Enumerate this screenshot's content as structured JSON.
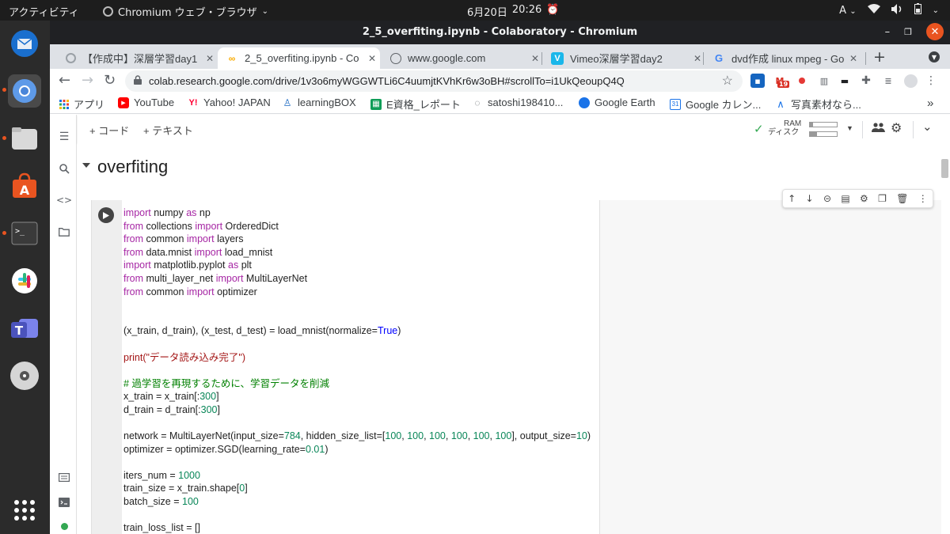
{
  "system": {
    "activities": "アクティビティ",
    "app_menu": "Chromium ウェブ・ブラウザ",
    "date": "6月20日",
    "time": "20:26",
    "input_method": "A"
  },
  "window": {
    "title": "2_5_overfiting.ipynb - Colaboratory - Chromium"
  },
  "tabs": [
    {
      "label": "【作成中】深層学習day1",
      "active": false
    },
    {
      "label": "2_5_overfiting.ipynb - Co",
      "active": true
    },
    {
      "label": "www.google.com",
      "active": false
    },
    {
      "label": "Vimeo深層学習day2",
      "active": false
    },
    {
      "label": "dvd作成 linux mpeg - Goo",
      "active": false
    }
  ],
  "toolbar": {
    "url": "colab.research.google.com/drive/1v3o6myWGGWTLi6C4uumjtKVhKr6w3oBH#scrollTo=i1UkQeoupQ4Q",
    "gmail_badge": "19"
  },
  "bookmarks": [
    {
      "label": "アプリ"
    },
    {
      "label": "YouTube"
    },
    {
      "label": "Yahoo! JAPAN"
    },
    {
      "label": "learningBOX"
    },
    {
      "label": "E資格_レポート"
    },
    {
      "label": "satoshi198410..."
    },
    {
      "label": "Google Earth"
    },
    {
      "label": "Google カレン..."
    },
    {
      "label": "写真素材なら..."
    }
  ],
  "colab": {
    "add_code": "+ コード",
    "add_text": "+ テキスト",
    "ram_label": "RAM",
    "disk_label": "ディスク",
    "ram_usage": 0.12,
    "disk_usage": 0.25,
    "section_title": "overfiting"
  },
  "code_lines": [
    [
      [
        "kw",
        "import"
      ],
      [
        "t",
        " numpy "
      ],
      [
        "kw",
        "as"
      ],
      [
        "t",
        " np"
      ]
    ],
    [
      [
        "kw",
        "from"
      ],
      [
        "t",
        " collections "
      ],
      [
        "kw",
        "import"
      ],
      [
        "t",
        " OrderedDict"
      ]
    ],
    [
      [
        "kw",
        "from"
      ],
      [
        "t",
        " common "
      ],
      [
        "kw",
        "import"
      ],
      [
        "t",
        " layers"
      ]
    ],
    [
      [
        "kw",
        "from"
      ],
      [
        "t",
        " data.mnist "
      ],
      [
        "kw",
        "import"
      ],
      [
        "t",
        " load_mnist"
      ]
    ],
    [
      [
        "kw",
        "import"
      ],
      [
        "t",
        " matplotlib.pyplot "
      ],
      [
        "kw",
        "as"
      ],
      [
        "t",
        " plt"
      ]
    ],
    [
      [
        "kw",
        "from"
      ],
      [
        "t",
        " multi_layer_net "
      ],
      [
        "kw",
        "import"
      ],
      [
        "t",
        " MultiLayerNet"
      ]
    ],
    [
      [
        "kw",
        "from"
      ],
      [
        "t",
        " common "
      ],
      [
        "kw",
        "import"
      ],
      [
        "t",
        " optimizer"
      ]
    ],
    [],
    [],
    [
      [
        "t",
        "(x_train, d_train), (x_test, d_test) = load_mnist(normalize="
      ],
      [
        "bool",
        "True"
      ],
      [
        "t",
        ")"
      ]
    ],
    [],
    [
      [
        "str",
        "print(\"データ読み込み完了\")"
      ]
    ],
    [],
    [
      [
        "cmt",
        "# 過学習を再現するために、学習データを削減"
      ]
    ],
    [
      [
        "t",
        "x_train = x_train[:"
      ],
      [
        "num",
        "300"
      ],
      [
        "t",
        "]"
      ]
    ],
    [
      [
        "t",
        "d_train = d_train[:"
      ],
      [
        "num",
        "300"
      ],
      [
        "t",
        "]"
      ]
    ],
    [],
    [
      [
        "t",
        "network = MultiLayerNet(input_size="
      ],
      [
        "num",
        "784"
      ],
      [
        "t",
        ", hidden_size_list=["
      ],
      [
        "num",
        "100"
      ],
      [
        "t",
        ", "
      ],
      [
        "num",
        "100"
      ],
      [
        "t",
        ", "
      ],
      [
        "num",
        "100"
      ],
      [
        "t",
        ", "
      ],
      [
        "num",
        "100"
      ],
      [
        "t",
        ", "
      ],
      [
        "num",
        "100"
      ],
      [
        "t",
        ", "
      ],
      [
        "num",
        "100"
      ],
      [
        "t",
        "], output_size="
      ],
      [
        "num",
        "10"
      ],
      [
        "t",
        ")"
      ]
    ],
    [
      [
        "t",
        "optimizer = optimizer.SGD(learning_rate="
      ],
      [
        "num",
        "0.01"
      ],
      [
        "t",
        ")"
      ]
    ],
    [],
    [
      [
        "t",
        "iters_num = "
      ],
      [
        "num",
        "1000"
      ]
    ],
    [
      [
        "t",
        "train_size = x_train.shape["
      ],
      [
        "num",
        "0"
      ],
      [
        "t",
        "]"
      ]
    ],
    [
      [
        "t",
        "batch_size = "
      ],
      [
        "num",
        "100"
      ]
    ],
    [],
    [
      [
        "t",
        "train_loss_list = []"
      ]
    ]
  ]
}
